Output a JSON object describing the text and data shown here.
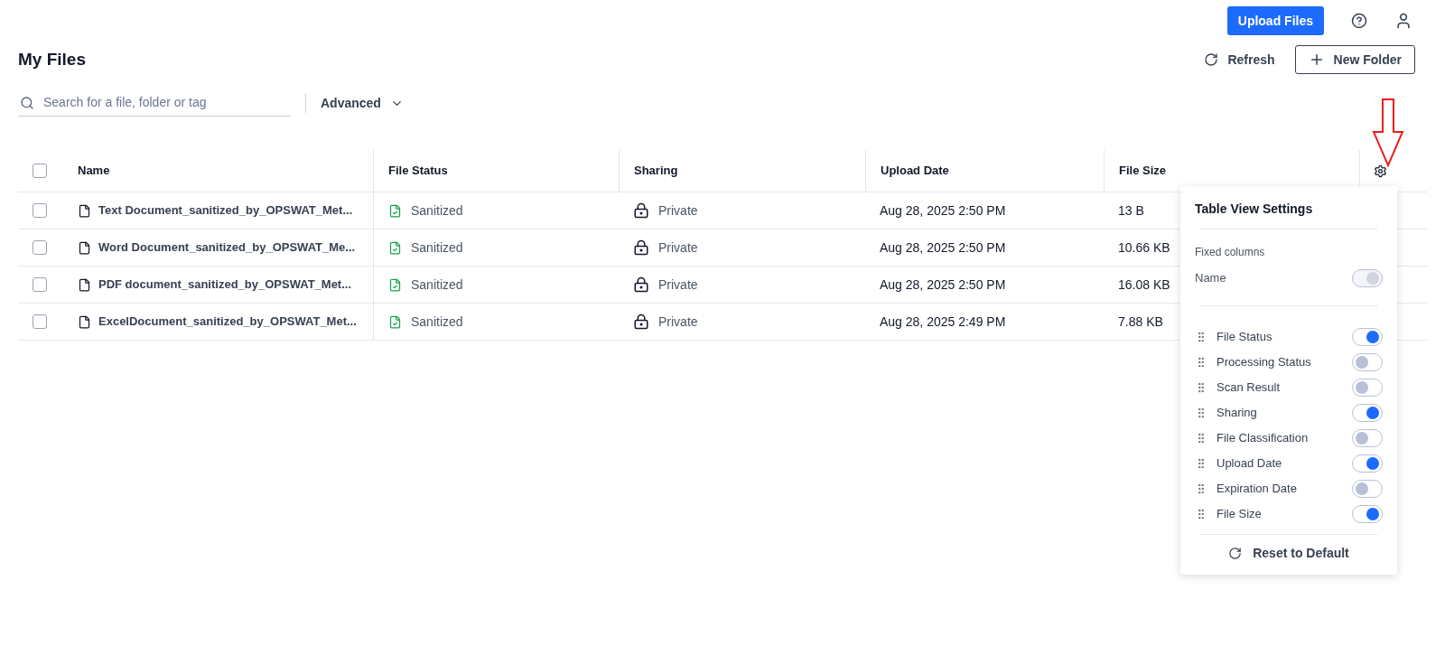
{
  "header": {
    "upload_button": "Upload Files"
  },
  "page": {
    "title": "My Files",
    "refresh": "Refresh",
    "new_folder": "New Folder"
  },
  "search": {
    "placeholder": "Search for a file, folder or tag",
    "advanced": "Advanced"
  },
  "table": {
    "all_checked": false,
    "columns": [
      "Name",
      "File Status",
      "Sharing",
      "Upload Date",
      "File Size"
    ],
    "rows": [
      {
        "checked": false,
        "name": "Text Document_sanitized_by_OPSWAT_Met...",
        "status": "Sanitized",
        "sharing": "Private",
        "date": "Aug 28, 2025 2:50 PM",
        "size": "13 B"
      },
      {
        "checked": false,
        "name": "Word Document_sanitized_by_OPSWAT_Me...",
        "status": "Sanitized",
        "sharing": "Private",
        "date": "Aug 28, 2025 2:50 PM",
        "size": "10.66 KB"
      },
      {
        "checked": false,
        "name": "PDF document_sanitized_by_OPSWAT_Met...",
        "status": "Sanitized",
        "sharing": "Private",
        "date": "Aug 28, 2025 2:50 PM",
        "size": "16.08 KB"
      },
      {
        "checked": false,
        "name": "ExcelDocument_sanitized_by_OPSWAT_Met...",
        "status": "Sanitized",
        "sharing": "Private",
        "date": "Aug 28, 2025 2:49 PM",
        "size": "7.88 KB"
      }
    ]
  },
  "settings": {
    "title": "Table View Settings",
    "fixed_label": "Fixed columns",
    "fixed": [
      {
        "label": "Name",
        "on": true,
        "disabled": true
      }
    ],
    "columns": [
      {
        "label": "File Status",
        "on": true
      },
      {
        "label": "Processing Status",
        "on": false
      },
      {
        "label": "Scan Result",
        "on": false
      },
      {
        "label": "Sharing",
        "on": true
      },
      {
        "label": "File Classification",
        "on": false
      },
      {
        "label": "Upload Date",
        "on": true
      },
      {
        "label": "Expiration Date",
        "on": false
      },
      {
        "label": "File Size",
        "on": true
      }
    ],
    "reset": "Reset to Default"
  }
}
